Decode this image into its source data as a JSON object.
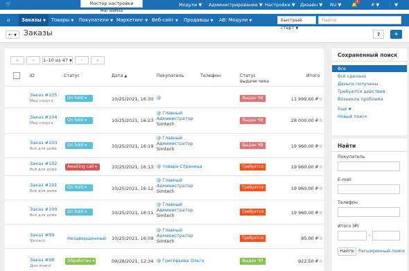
{
  "topbar": {
    "cart_icon": "cart-icon",
    "wizard": "Мастер настройки магазина",
    "menu": [
      "Модули",
      "Администрирование",
      "Настройки",
      "Дизайн",
      "RU",
      "₽"
    ],
    "badge": "1"
  },
  "nav": {
    "home_icon": "home-icon",
    "items": [
      "Заказы",
      "Товары",
      "Покупатели",
      "Маркетинг",
      "Веб-сайт",
      "Продавцы",
      "AB: Модули"
    ],
    "quick_start": "Быстрый старт",
    "search_placeholder": "Найти"
  },
  "page": {
    "title": "Заказы",
    "help": "?",
    "add": "+"
  },
  "pager": {
    "first": "«",
    "prev": "‹",
    "range": "1–10 из 47",
    "next": "›",
    "last": "»"
  },
  "table": {
    "headers": {
      "id": "ID",
      "status": "Статус",
      "date": "Дата",
      "customer": "Покупатель",
      "phone": "Телефон",
      "receipt_line1": "Статус",
      "receipt_line2": "выдачи чека",
      "total": "Итого"
    },
    "rows": [
      {
        "id": "Заказ #105",
        "store": "Мир спорта",
        "status": "On hold",
        "date": "10/25/2021, 16:30",
        "cust1": "@",
        "cust2": "",
        "cust3": "",
        "receipt": "Выдан ЧВ",
        "total": "11 999.60 ₽"
      },
      {
        "id": "Заказ #104",
        "store": "Мир спорта",
        "status": "On hold",
        "date": "10/25/2021, 16:23",
        "cust1": "@ Главный",
        "cust2": "Администратор",
        "cust3": "Simtech",
        "receipt": "Выдан ЧВ",
        "total": "28 000.00 ₽"
      },
      {
        "id": "Заказ #103",
        "store": "Всё для дома",
        "status": "On hold",
        "date": "10/25/2021, 16:19",
        "cust1": "@ Главный",
        "cust2": "Администратор",
        "cust3": "Simtech",
        "receipt": "Выдан ЧВ",
        "total": "19 960.00 ₽"
      },
      {
        "id": "Заказ #102",
        "store": "Всё для дома",
        "status": "Awaiting call",
        "date": "10/25/2021, 16:13",
        "cust1": "@ товара Страница",
        "cust2": "",
        "cust3": "",
        "receipt": "Требуется",
        "total": "19 960.00 ₽"
      },
      {
        "id": "Заказ #101",
        "store": "Всё для дома",
        "status": "On hold",
        "date": "10/25/2021, 16:12",
        "cust1": "@ Главный",
        "cust2": "Администратор",
        "cust3": "Simtech",
        "receipt": "Требуется",
        "total": "19 960.00 ₽"
      },
      {
        "id": "Заказ #100",
        "store": "Всё для дома",
        "status": "On hold",
        "date": "10/25/2021, 16:11",
        "cust1": "@ Главный",
        "cust2": "Администратор",
        "cust3": "Simtech",
        "receipt": "Требуется",
        "total": "19 960.00 ₽"
      },
      {
        "id": "Заказ #99",
        "store": "Simtech",
        "status": "Незавершенный",
        "date": "10/25/2021, 16:09",
        "cust1": "@ Главный",
        "cust2": "Администратор",
        "cust3": "Simtech",
        "receipt": "Требуется",
        "total": "85.00 ₽"
      },
      {
        "id": "Заказ #98",
        "store": "Дом книги",
        "status": "Обработан",
        "date": "09/28/2021, 12:34",
        "cust1": "@ Григорьева Ольга",
        "cust2": "",
        "cust3": "",
        "receipt": "Выдан ЧП",
        "total": "922.50 ₽"
      }
    ]
  },
  "saved_search": {
    "title": "Сохраненный поиск",
    "items": [
      "Все",
      "Всё сделано",
      "Деньги получены",
      "Требуются действия",
      "Возникла проблема",
      "Еще",
      "Новый поиск"
    ]
  },
  "find": {
    "title": "Найти",
    "customer_label": "Покупатель",
    "email_label": "E-mail",
    "phone_label": "Телефон",
    "total_label": "Итого (₽)",
    "dash": "-",
    "find_button": "Найти",
    "advanced": "Расширенный поиск"
  },
  "colors": {
    "primary": "#1b70b5",
    "on_hold": "#5bc0de",
    "awaiting_call": "#d9534f",
    "processed": "#8cc152",
    "receipt_issued": "#e57373",
    "receipt_required": "#f4511e",
    "receipt_issued_green": "#8cc152"
  }
}
